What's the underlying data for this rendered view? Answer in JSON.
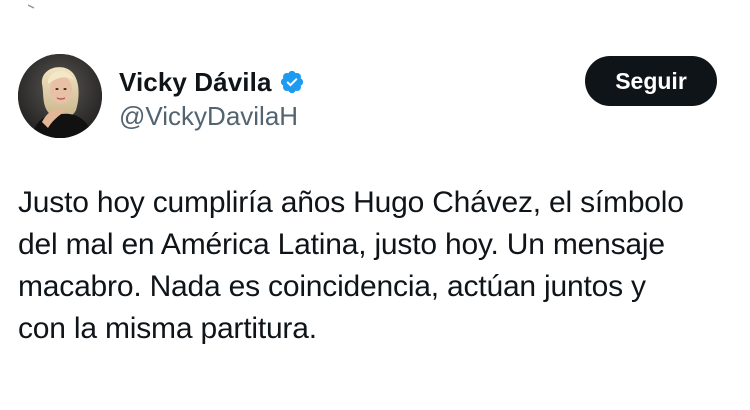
{
  "author": {
    "display_name": "Vicky Dávila",
    "handle": "@VickyDavilaH",
    "verified": true,
    "avatar_icon": "profile-photo-avatar"
  },
  "actions": {
    "follow_label": "Seguir"
  },
  "tweet": {
    "lines": [
      "Justo hoy cumpliría años Hugo Chávez, el símbolo",
      "del mal en América Latina, justo hoy. Un mensaje",
      "macabro. Nada es coincidencia, actúan juntos y",
      "con la misma partitura."
    ]
  },
  "colors": {
    "text_primary": "#0f1419",
    "text_secondary": "#536471",
    "verified_badge": "#1d9bf0",
    "follow_button_bg": "#0f1419",
    "follow_button_text": "#ffffff",
    "background": "#ffffff"
  }
}
